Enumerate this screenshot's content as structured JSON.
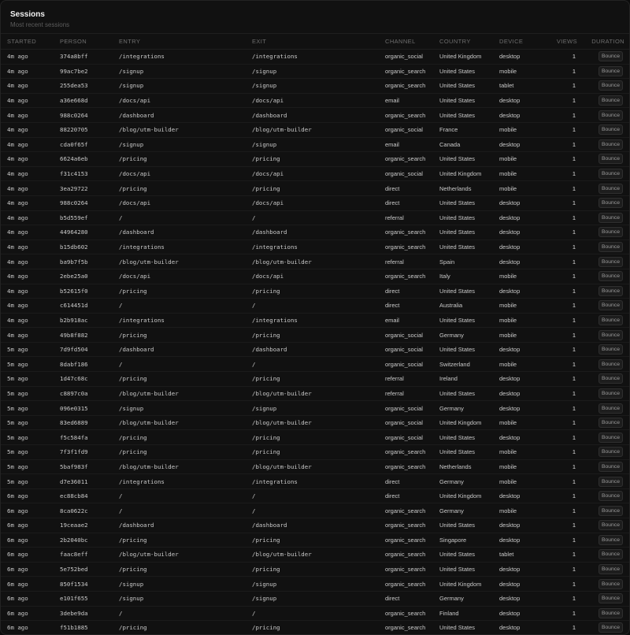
{
  "header": {
    "title": "Sessions",
    "subtitle": "Most recent sessions"
  },
  "columns": [
    "STARTED",
    "PERSON",
    "ENTRY",
    "EXIT",
    "CHANNEL",
    "COUNTRY",
    "DEVICE",
    "VIEWS",
    "DURATION"
  ],
  "rows": [
    [
      "4m ago",
      "374a8bff",
      "/integrations",
      "/integrations",
      "organic_social",
      "United Kingdom",
      "desktop",
      "1",
      "Bounce"
    ],
    [
      "4m ago",
      "99ac7be2",
      "/signup",
      "/signup",
      "organic_search",
      "United States",
      "mobile",
      "1",
      "Bounce"
    ],
    [
      "4m ago",
      "255dea53",
      "/signup",
      "/signup",
      "organic_search",
      "United States",
      "tablet",
      "1",
      "Bounce"
    ],
    [
      "4m ago",
      "a36e668d",
      "/docs/api",
      "/docs/api",
      "email",
      "United States",
      "desktop",
      "1",
      "Bounce"
    ],
    [
      "4m ago",
      "988c0264",
      "/dashboard",
      "/dashboard",
      "organic_search",
      "United States",
      "desktop",
      "1",
      "Bounce"
    ],
    [
      "4m ago",
      "88220705",
      "/blog/utm-builder",
      "/blog/utm-builder",
      "organic_social",
      "France",
      "mobile",
      "1",
      "Bounce"
    ],
    [
      "4m ago",
      "cda0f65f",
      "/signup",
      "/signup",
      "email",
      "Canada",
      "desktop",
      "1",
      "Bounce"
    ],
    [
      "4m ago",
      "6624a6eb",
      "/pricing",
      "/pricing",
      "organic_search",
      "United States",
      "mobile",
      "1",
      "Bounce"
    ],
    [
      "4m ago",
      "f31c4153",
      "/docs/api",
      "/docs/api",
      "organic_social",
      "United Kingdom",
      "mobile",
      "1",
      "Bounce"
    ],
    [
      "4m ago",
      "3ea29722",
      "/pricing",
      "/pricing",
      "direct",
      "Netherlands",
      "mobile",
      "1",
      "Bounce"
    ],
    [
      "4m ago",
      "988c0264",
      "/docs/api",
      "/docs/api",
      "direct",
      "United States",
      "desktop",
      "1",
      "Bounce"
    ],
    [
      "4m ago",
      "b5d559ef",
      "/",
      "/",
      "referral",
      "United States",
      "desktop",
      "1",
      "Bounce"
    ],
    [
      "4m ago",
      "44964280",
      "/dashboard",
      "/dashboard",
      "organic_search",
      "United States",
      "desktop",
      "1",
      "Bounce"
    ],
    [
      "4m ago",
      "b15db602",
      "/integrations",
      "/integrations",
      "organic_search",
      "United States",
      "desktop",
      "1",
      "Bounce"
    ],
    [
      "4m ago",
      "ba9b7f5b",
      "/blog/utm-builder",
      "/blog/utm-builder",
      "referral",
      "Spain",
      "desktop",
      "1",
      "Bounce"
    ],
    [
      "4m ago",
      "2ebe25a0",
      "/docs/api",
      "/docs/api",
      "organic_search",
      "Italy",
      "mobile",
      "1",
      "Bounce"
    ],
    [
      "4m ago",
      "b52615f0",
      "/pricing",
      "/pricing",
      "direct",
      "United States",
      "desktop",
      "1",
      "Bounce"
    ],
    [
      "4m ago",
      "c614451d",
      "/",
      "/",
      "direct",
      "Australia",
      "mobile",
      "1",
      "Bounce"
    ],
    [
      "4m ago",
      "b2b918ac",
      "/integrations",
      "/integrations",
      "email",
      "United States",
      "mobile",
      "1",
      "Bounce"
    ],
    [
      "4m ago",
      "49b8f882",
      "/pricing",
      "/pricing",
      "organic_social",
      "Germany",
      "mobile",
      "1",
      "Bounce"
    ],
    [
      "5m ago",
      "7d9fd504",
      "/dashboard",
      "/dashboard",
      "organic_social",
      "United States",
      "desktop",
      "1",
      "Bounce"
    ],
    [
      "5m ago",
      "8dabf186",
      "/",
      "/",
      "organic_social",
      "Switzerland",
      "mobile",
      "1",
      "Bounce"
    ],
    [
      "5m ago",
      "1d47c68c",
      "/pricing",
      "/pricing",
      "referral",
      "Ireland",
      "desktop",
      "1",
      "Bounce"
    ],
    [
      "5m ago",
      "c8897c0a",
      "/blog/utm-builder",
      "/blog/utm-builder",
      "referral",
      "United States",
      "desktop",
      "1",
      "Bounce"
    ],
    [
      "5m ago",
      "096e0315",
      "/signup",
      "/signup",
      "organic_social",
      "Germany",
      "desktop",
      "1",
      "Bounce"
    ],
    [
      "5m ago",
      "83ed6889",
      "/blog/utm-builder",
      "/blog/utm-builder",
      "organic_social",
      "United Kingdom",
      "mobile",
      "1",
      "Bounce"
    ],
    [
      "5m ago",
      "f5c584fa",
      "/pricing",
      "/pricing",
      "organic_social",
      "United States",
      "desktop",
      "1",
      "Bounce"
    ],
    [
      "5m ago",
      "7f3f1fd9",
      "/pricing",
      "/pricing",
      "organic_search",
      "United States",
      "mobile",
      "1",
      "Bounce"
    ],
    [
      "5m ago",
      "5baf983f",
      "/blog/utm-builder",
      "/blog/utm-builder",
      "organic_search",
      "Netherlands",
      "mobile",
      "1",
      "Bounce"
    ],
    [
      "5m ago",
      "d7e36011",
      "/integrations",
      "/integrations",
      "direct",
      "Germany",
      "mobile",
      "1",
      "Bounce"
    ],
    [
      "6m ago",
      "ec88cb84",
      "/",
      "/",
      "direct",
      "United Kingdom",
      "desktop",
      "1",
      "Bounce"
    ],
    [
      "6m ago",
      "8ca0622c",
      "/",
      "/",
      "organic_search",
      "Germany",
      "mobile",
      "1",
      "Bounce"
    ],
    [
      "6m ago",
      "19ceaae2",
      "/dashboard",
      "/dashboard",
      "organic_search",
      "United States",
      "desktop",
      "1",
      "Bounce"
    ],
    [
      "6m ago",
      "2b2040bc",
      "/pricing",
      "/pricing",
      "organic_search",
      "Singapore",
      "desktop",
      "1",
      "Bounce"
    ],
    [
      "6m ago",
      "faac8eff",
      "/blog/utm-builder",
      "/blog/utm-builder",
      "organic_search",
      "United States",
      "tablet",
      "1",
      "Bounce"
    ],
    [
      "6m ago",
      "5e752bed",
      "/pricing",
      "/pricing",
      "organic_search",
      "United States",
      "desktop",
      "1",
      "Bounce"
    ],
    [
      "6m ago",
      "850f1534",
      "/signup",
      "/signup",
      "organic_search",
      "United Kingdom",
      "desktop",
      "1",
      "Bounce"
    ],
    [
      "6m ago",
      "e101f655",
      "/signup",
      "/signup",
      "direct",
      "Germany",
      "desktop",
      "1",
      "Bounce"
    ],
    [
      "6m ago",
      "3debe9da",
      "/",
      "/",
      "organic_search",
      "Finland",
      "desktop",
      "1",
      "Bounce"
    ],
    [
      "6m ago",
      "f51b1885",
      "/pricing",
      "/pricing",
      "organic_search",
      "United States",
      "desktop",
      "1",
      "Bounce"
    ]
  ]
}
